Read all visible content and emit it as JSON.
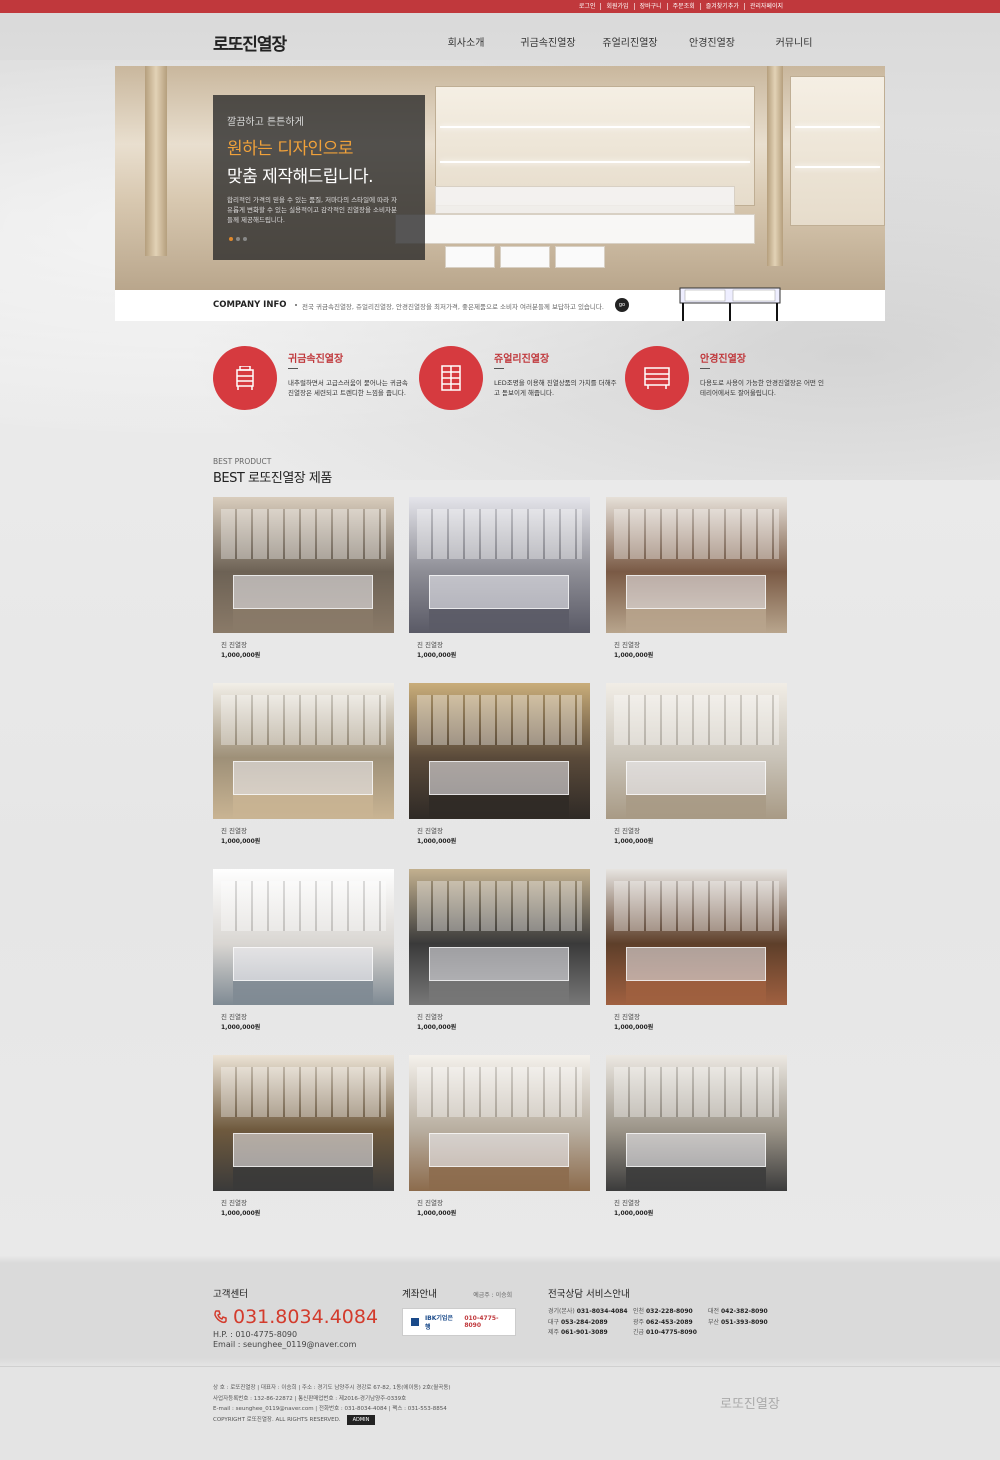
{
  "top_links": [
    "로그인",
    "회원가입",
    "장바구니",
    "주문조회",
    "즐겨찾기추가",
    "관리자페이지"
  ],
  "logo": "로또진열장",
  "nav": [
    "회사소개",
    "귀금속진열장",
    "쥬얼리진열장",
    "안경진열장",
    "커뮤니티"
  ],
  "hero": {
    "line1": "깔끔하고 튼튼하게",
    "line2": "원하는 디자인으로",
    "line3": "맞춤 제작해드립니다.",
    "desc": "합리적인 가격의 믿을 수 있는 품질, 저마다의 스타일에 따라 자유롭게 변화할 수 있는 실용적이고 감각적인 진열장을 소비자분들께 제공해드립니다."
  },
  "info": {
    "title": "COMPANY INFO",
    "desc": "전국 귀금속진열장, 쥬얼리진열장, 안경진열장을 최저가격, 좋은제품으로 소비자 여러분들께 보답하고 있습니다.",
    "go": "go"
  },
  "features": [
    {
      "title": "귀금속진열장",
      "desc": "내추럴하면서 고급스러움이 묻어나는 귀금속진열장은 세련되고 트렌디한 느낌을 줍니다.",
      "icon": "display-cabinet-icon"
    },
    {
      "title": "쥬얼리진열장",
      "desc": "LED조명을 이용해 진열상품의 가치를 더해주고 돋보이게 해줍니다.",
      "icon": "showcase-icon"
    },
    {
      "title": "안경진열장",
      "desc": "다용도로 사용이 가능한 안경진열장은 어떤 인테리어에서도 잘어울립니다.",
      "icon": "drawer-icon"
    }
  ],
  "best": {
    "sub": "BEST PRODUCT",
    "title": "BEST 로또진열장 제품"
  },
  "products": [
    {
      "name": "진 진열장",
      "price": "1,000,000원"
    },
    {
      "name": "진 진열장",
      "price": "1,000,000원"
    },
    {
      "name": "진 진열장",
      "price": "1,000,000원"
    },
    {
      "name": "진 진열장",
      "price": "1,000,000원"
    },
    {
      "name": "진 진열장",
      "price": "1,000,000원"
    },
    {
      "name": "진 진열장",
      "price": "1,000,000원"
    },
    {
      "name": "진 진열장",
      "price": "1,000,000원"
    },
    {
      "name": "진 진열장",
      "price": "1,000,000원"
    },
    {
      "name": "진 진열장",
      "price": "1,000,000원"
    },
    {
      "name": "진 진열장",
      "price": "1,000,000원"
    },
    {
      "name": "진 진열장",
      "price": "1,000,000원"
    },
    {
      "name": "진 진열장",
      "price": "1,000,000원"
    }
  ],
  "footer": {
    "cs_title": "고객센터",
    "phone": "031.8034.4084",
    "hp": "H.P.  : 010-4775-8090",
    "email": "Email : seunghee_0119@naver.com",
    "account_title": "계좌안내",
    "holder": "예금주 : 이승희",
    "bank_name": "IBK기업은행",
    "bank_no": "010-4775-8090",
    "region_title": "전국상담 서비스안내",
    "regions": [
      {
        "name": "경기(본사)",
        "tel": "031-8034-4084"
      },
      {
        "name": "인천",
        "tel": "032-228-8090"
      },
      {
        "name": "대전",
        "tel": "042-382-8090"
      },
      {
        "name": "대구",
        "tel": "053-284-2089"
      },
      {
        "name": "광주",
        "tel": "062-453-2089"
      },
      {
        "name": "부산",
        "tel": "051-393-8090"
      },
      {
        "name": "제주",
        "tel": "061-901-3089"
      },
      {
        "name": "긴급",
        "tel": "010-4775-8090"
      }
    ],
    "info1": "상 호 : 로또진열장 | 대표자 : 이승희 | 주소 : 경기도 남양주시 경강로 67-82, 1동(에이동) 2호(월곡동)",
    "info2": "사업자등록번호 : 132-86-22872 | 통신판매업번호 : 제2016-경기남양주-0339호",
    "info3": "E-mail : seunghee_0119@naver.com | 전화번호 : 031-8034-4084 | 팩스 : 031-553-8854",
    "copyright": "COPYRIGHT 로또진열장. ALL RIGHTS RESERVED.",
    "admin": "ADMIN",
    "logo": "로또진열장"
  }
}
